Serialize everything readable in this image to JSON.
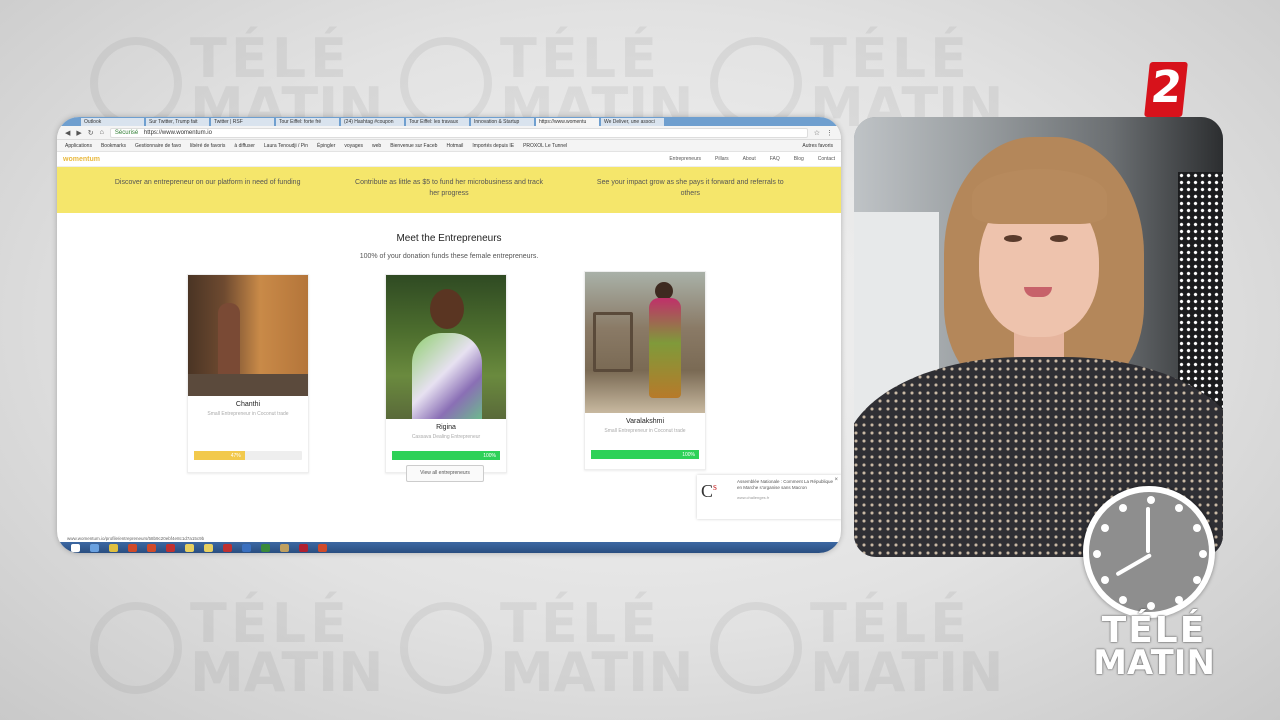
{
  "channel_logo": {
    "text": "2",
    "color": "#d7121b"
  },
  "show_logo": {
    "line1": "TÉLÉ",
    "line2": "MATIN"
  },
  "browser": {
    "tabs": [
      "Outlook",
      "Sur Twitter, Trump fait",
      "Twitter | RSF",
      "Tour Eiffel: forte fré",
      "(24) Hashtag #coupon",
      "Tour Eiffel: les travaux",
      "Innovation & Startup",
      "https://www.womentu",
      "We Deliver, une associ"
    ],
    "url": "https://www.womentum.io",
    "secure_label": "Sécurisé",
    "bookmarks": [
      "Applications",
      "Bookmarks",
      "Gestionnaire de favo",
      "libéré de favoris",
      "à diffuser",
      "Laura Tenoudji / Pin",
      "Épingler",
      "voyages",
      "web",
      "Bienvenue sur Faceb",
      "Hotmail",
      "Importés depuis IE",
      "PROXOL Le Tunnel",
      "Autres favoris"
    ]
  },
  "site": {
    "logo": "womentum",
    "nav": [
      "Entrepreneurs",
      "Pillars",
      "About",
      "FAQ",
      "Blog",
      "Contact"
    ],
    "steps": [
      "Discover an entrepreneur on our platform in need of funding",
      "Contribute as little as $5 to fund her microbusiness and track her progress",
      "See your impact grow as she pays it forward and referrals to others"
    ],
    "section_title": "Meet the Entrepreneurs",
    "section_subtitle": "100% of your donation funds these female entrepreneurs.",
    "view_all": "View all entrepreneurs",
    "status_url": "www.womentum.io/profile/entrepreneurs/58b9c20ebf4e8c1d7a15c9b"
  },
  "entrepreneurs": [
    {
      "name": "Chanthi",
      "role": "Small Entrepreneur in Coconut trade",
      "progress": 0.47,
      "progress_label": "47%",
      "bar_color": "#f2c94c"
    },
    {
      "name": "Rigina",
      "role": "Cassava Dealing Entrepreneur",
      "progress": 1.0,
      "progress_label": "100%",
      "bar_color": "#2ed158"
    },
    {
      "name": "Varalakshmi",
      "role": "Small Entrepreneur in Coconut trade",
      "progress": 1.0,
      "progress_label": "100%",
      "bar_color": "#2ed158"
    }
  ],
  "toast": {
    "logo": "C",
    "logo_sup": "s",
    "text": "Assemblée Nationale : Comment La République en Marche s'organise sans Macron",
    "site": "www.challenges.fr",
    "close": "×"
  }
}
